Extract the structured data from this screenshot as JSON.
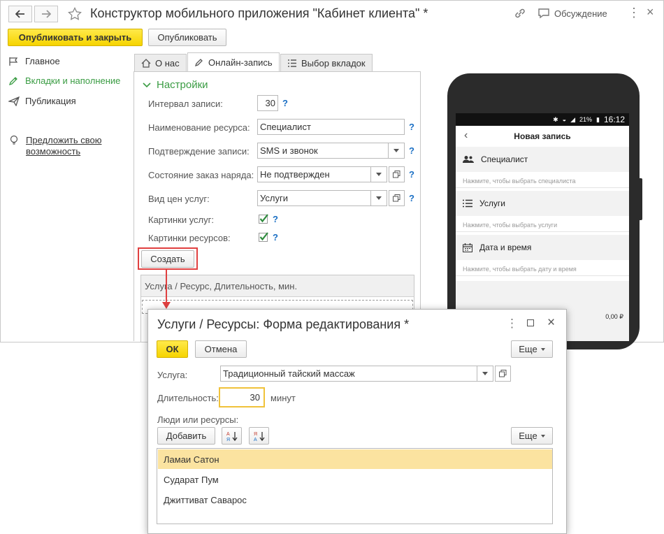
{
  "window": {
    "title": "Конструктор мобильного приложения \"Кабинет клиента\" *",
    "discussion_label": "Обсуждение"
  },
  "toolbar": {
    "publish_close_label": "Опубликовать и закрыть",
    "publish_label": "Опубликовать"
  },
  "sidebar": {
    "items": [
      {
        "label": "Главное"
      },
      {
        "label": "Вкладки и наполнение"
      },
      {
        "label": "Публикация"
      }
    ],
    "suggest_line1": "Предложить свою",
    "suggest_line2": "возможность"
  },
  "tabs": [
    {
      "label": "О нас"
    },
    {
      "label": "Онлайн-запись"
    },
    {
      "label": "Выбор вкладок"
    }
  ],
  "settings": {
    "header": "Настройки",
    "interval_label": "Интервал записи:",
    "interval_value": "30",
    "resource_label": "Наименование ресурса:",
    "resource_value": "Специалист",
    "confirm_label": "Подтверждение записи:",
    "confirm_value": "SMS и звонок",
    "order_state_label": "Состояние заказ наряда:",
    "order_state_value": "Не подтвержден",
    "price_kind_label": "Вид цен услуг:",
    "price_kind_value": "Услуги",
    "service_images_label": "Картинки услуг:",
    "resource_images_label": "Картинки ресурсов:",
    "help_mark": "?",
    "create_label": "Создать",
    "table_header": "Услуга / Ресурс, Длительность, мин."
  },
  "phone": {
    "time": "16:12",
    "battery": "21%",
    "header": "Новая запись",
    "sections": [
      {
        "title": "Специалист",
        "hint": "Нажмите, чтобы выбрать специалиста"
      },
      {
        "title": "Услуги",
        "hint": "Нажмите, чтобы выбрать услуги"
      },
      {
        "title": "Дата и время",
        "hint": "Нажмите, чтобы выбрать дату и время"
      }
    ],
    "total": "0,00 ₽"
  },
  "dialog": {
    "title": "Услуги / Ресурсы: Форма редактирования *",
    "ok_label": "ОК",
    "cancel_label": "Отмена",
    "more_label": "Еще",
    "service_label": "Услуга:",
    "service_value": "Традиционный тайский массаж",
    "duration_label": "Длительность:",
    "duration_value": "30",
    "duration_unit": "минут",
    "people_label": "Люди или ресурсы:",
    "add_label": "Добавить",
    "more2_label": "Еще",
    "people": [
      "Ламаи Сатон",
      "Сударат Пум",
      "Джиттиват Саварос"
    ]
  },
  "colors": {
    "accent_green": "#3a9c43",
    "accent_yellow": "#f6d400",
    "highlight_red": "#e04040",
    "selected_row": "#fbe3a0"
  }
}
